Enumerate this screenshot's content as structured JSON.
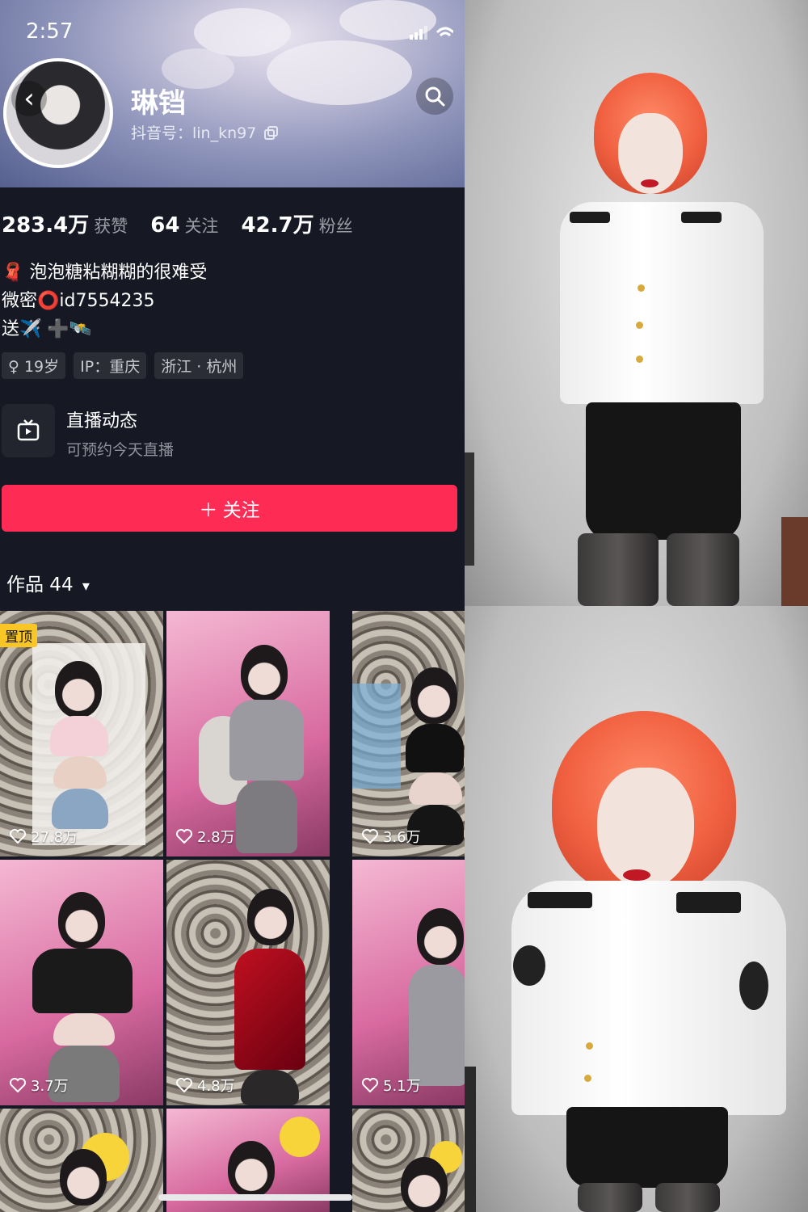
{
  "status_bar": {
    "time": "2:57"
  },
  "profile": {
    "name": "琳铛",
    "douyin_id": "抖音号：lin_kn97"
  },
  "stats": [
    {
      "value": "283.4万",
      "label": "获赞"
    },
    {
      "value": "64",
      "label": "关注"
    },
    {
      "value": "42.7万",
      "label": "粉丝"
    }
  ],
  "bio": {
    "line1": "🧣 泡泡糖粘糊糊的很难受",
    "line2": "微密⭕id7554235",
    "line3": "送✈️ ➕🛰️"
  },
  "tags": [
    "♀ 19岁",
    "IP：重庆",
    "浙江 · 杭州"
  ],
  "live": {
    "title": "直播动态",
    "subtitle": "可预约今天直播"
  },
  "follow_button": "＋ 关注",
  "works": {
    "label": "作品 44",
    "caret": "▾"
  },
  "pin_label": "置顶",
  "videos": [
    {
      "likes": "27.8万"
    },
    {
      "likes": "2.8万"
    },
    {
      "likes": "3.6万"
    },
    {
      "likes": "3.7万"
    },
    {
      "likes": "4.8万"
    },
    {
      "likes": "5.1万"
    }
  ],
  "colors": {
    "follow": "#fe2c55",
    "background": "#161823",
    "pin": "#fac625"
  },
  "icons": [
    "back-icon",
    "search-icon",
    "copy-icon",
    "tv-icon",
    "heart-icon",
    "signal-icon",
    "wifi-icon"
  ]
}
